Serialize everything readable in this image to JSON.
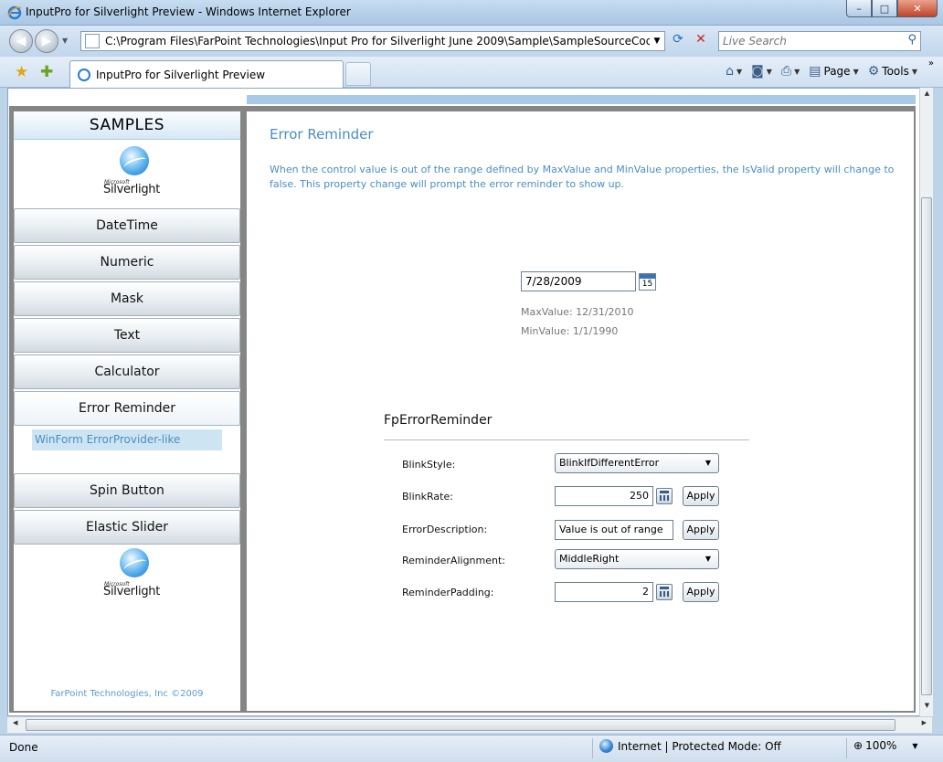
{
  "window": {
    "title": "InputPro for Silverlight Preview - Windows Internet Explorer",
    "min_glyph": "–",
    "max_glyph": "□",
    "close_glyph": "✕"
  },
  "address": {
    "url": "C:\\Program Files\\FarPoint Technologies\\Input Pro for Silverlight June 2009\\Sample\\SampleSourceCode\\Bin\\Debu",
    "search_placeholder": "Live Search"
  },
  "tab": {
    "label": "InputPro for Silverlight Preview"
  },
  "commands": {
    "page_label": "Page",
    "tools_label": "Tools"
  },
  "sidebar": {
    "header": "SAMPLES",
    "logo_small_text": "Microsoft",
    "logo_text": "Silverlight",
    "items": [
      {
        "label": "DateTime"
      },
      {
        "label": "Numeric"
      },
      {
        "label": "Mask"
      },
      {
        "label": "Text"
      },
      {
        "label": "Calculator"
      },
      {
        "label": "Error Reminder"
      },
      {
        "label": "Spin Button"
      },
      {
        "label": "Elastic Slider"
      }
    ],
    "subitem": "WinForm ErrorProvider-like",
    "footer": "FarPoint Technologies, Inc  ©2009"
  },
  "main": {
    "title": "Error Reminder",
    "description": "When the control value is out of the range defined by MaxValue and MinValue properties, the IsValid property will change to false. This property change will prompt the error reminder to show up.",
    "date_value": "7/28/2009",
    "calendar_day": "15",
    "max_value": "MaxValue: 12/31/2010",
    "min_value": "MinValue:  1/1/1990",
    "section_title": "FpErrorReminder",
    "props": {
      "blink_style_label": "BlinkStyle:",
      "blink_style_value": "BlinkIfDifferentError",
      "blink_rate_label": "BlinkRate:",
      "blink_rate_value": "250",
      "error_desc_label": "ErrorDescription:",
      "error_desc_value": "Value is out of range",
      "alignment_label": "ReminderAlignment:",
      "alignment_value": "MiddleRight",
      "padding_label": "ReminderPadding:",
      "padding_value": "2",
      "apply_label": "Apply"
    }
  },
  "status": {
    "left": "Done",
    "zone": "Internet | Protected Mode: Off",
    "zoom": "100%"
  }
}
